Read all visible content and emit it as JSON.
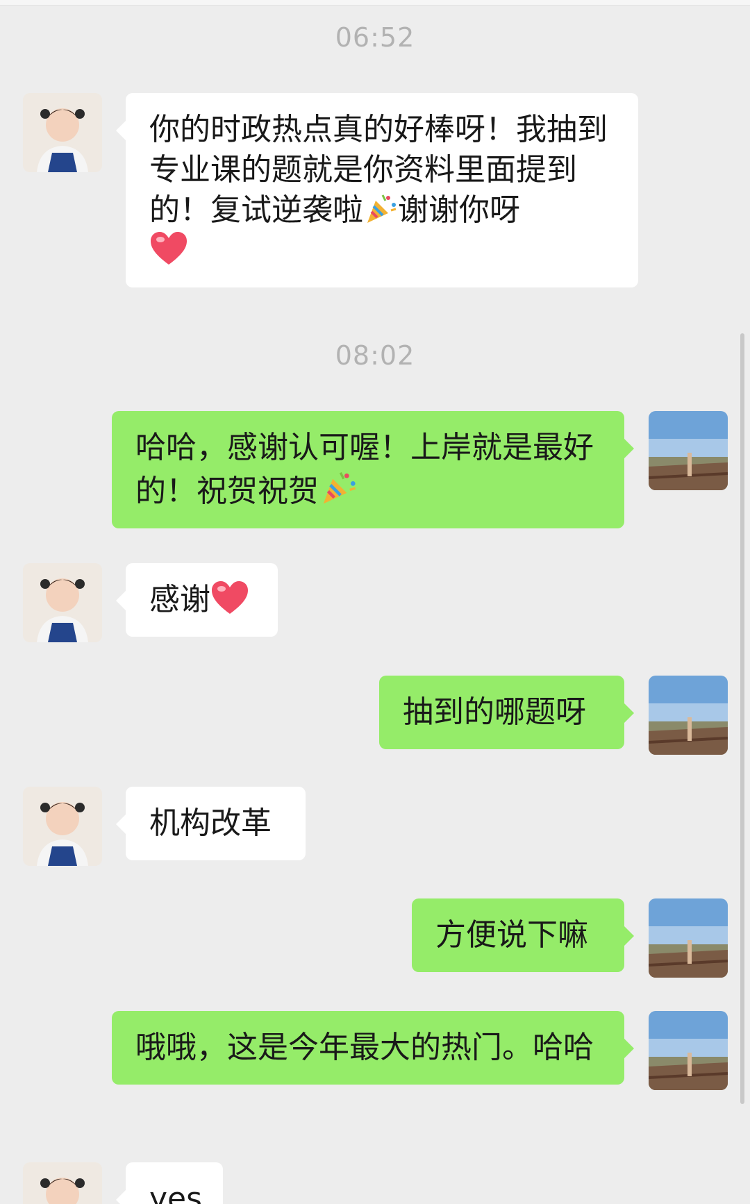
{
  "chat": {
    "timestamps": [
      "06:52",
      "08:02"
    ],
    "messages": [
      {
        "sender": "contact",
        "text": "你的时政热点真的好棒呀！我抽到专业课的题就是你资料里面提到的！复试逆袭啦",
        "text_after": "谢谢你呀",
        "emojis": [
          "party-popper",
          "heart"
        ]
      },
      {
        "sender": "me",
        "text": "哈哈，感谢认可喔！上岸就是最好的！祝贺祝贺",
        "emojis": [
          "party-popper"
        ]
      },
      {
        "sender": "contact",
        "text": "感谢",
        "emojis": [
          "heart"
        ]
      },
      {
        "sender": "me",
        "text": "抽到的哪题呀"
      },
      {
        "sender": "contact",
        "text": "机构改革"
      },
      {
        "sender": "me",
        "text": "方便说下嘛"
      },
      {
        "sender": "me",
        "text": "哦哦，这是今年最大的热门。哈哈"
      },
      {
        "sender": "contact",
        "text": "yes"
      }
    ]
  },
  "colors": {
    "background": "#ededed",
    "incoming_bubble": "#ffffff",
    "outgoing_bubble": "#95ec69",
    "timestamp_text": "#b2b2b2"
  }
}
